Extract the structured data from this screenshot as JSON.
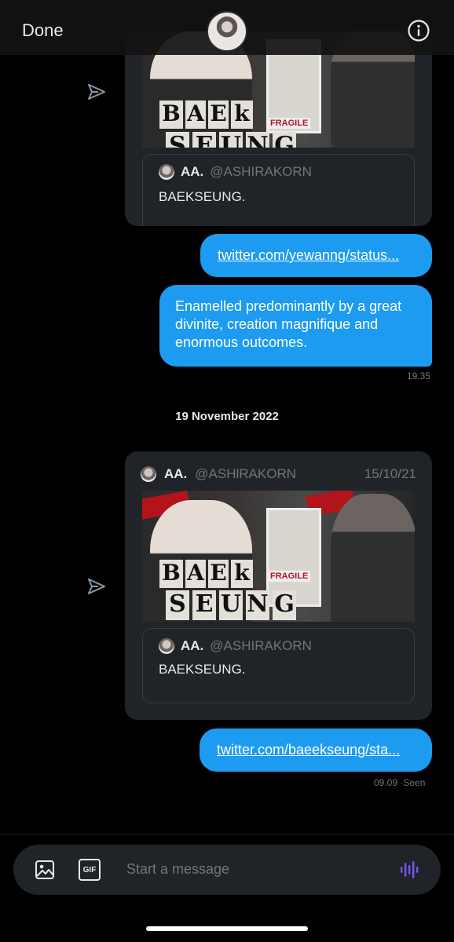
{
  "header": {
    "done_label": "Done",
    "avatar_icon": "profile-avatar",
    "info_icon": "info-icon"
  },
  "messages": {
    "card1": {
      "quote_name": "AA.",
      "quote_handle": "@ASHIRAKORN",
      "quote_text": "BAEKSEUNG.",
      "image_text": [
        "B",
        "A",
        "E",
        "k",
        "S",
        "E",
        "U",
        "N",
        "G"
      ],
      "poster_label": "FRAGILE"
    },
    "link1": "twitter.com/yewanng/status...",
    "text1": "Enamelled predominantly by a great divinite, creation magnifique and enormous outcomes.",
    "time1": "19.35",
    "date_separator": "19 November 2022",
    "card2": {
      "author_name": "AA.",
      "author_handle": "@ASHlRAKORN",
      "date": "15/10/21",
      "quote_name": "AA.",
      "quote_handle": "@ASHIRAKORN",
      "quote_text": "BAEKSEUNG.",
      "image_text": [
        "B",
        "A",
        "E",
        "k",
        "S",
        "E",
        "U",
        "N",
        "G"
      ],
      "poster_label": "FRAGILE"
    },
    "link2": "twitter.com/baeekseung/sta...",
    "status2": "09.09 ·Seen"
  },
  "composer": {
    "placeholder": "Start a message",
    "image_icon": "image-icon",
    "gif_icon": "gif-icon",
    "gif_label": "GIF",
    "voice_icon": "voice-icon"
  },
  "colors": {
    "accent": "#1d9bf0",
    "card_bg": "#202327",
    "muted": "#71767b",
    "voice": "#7856ff"
  }
}
